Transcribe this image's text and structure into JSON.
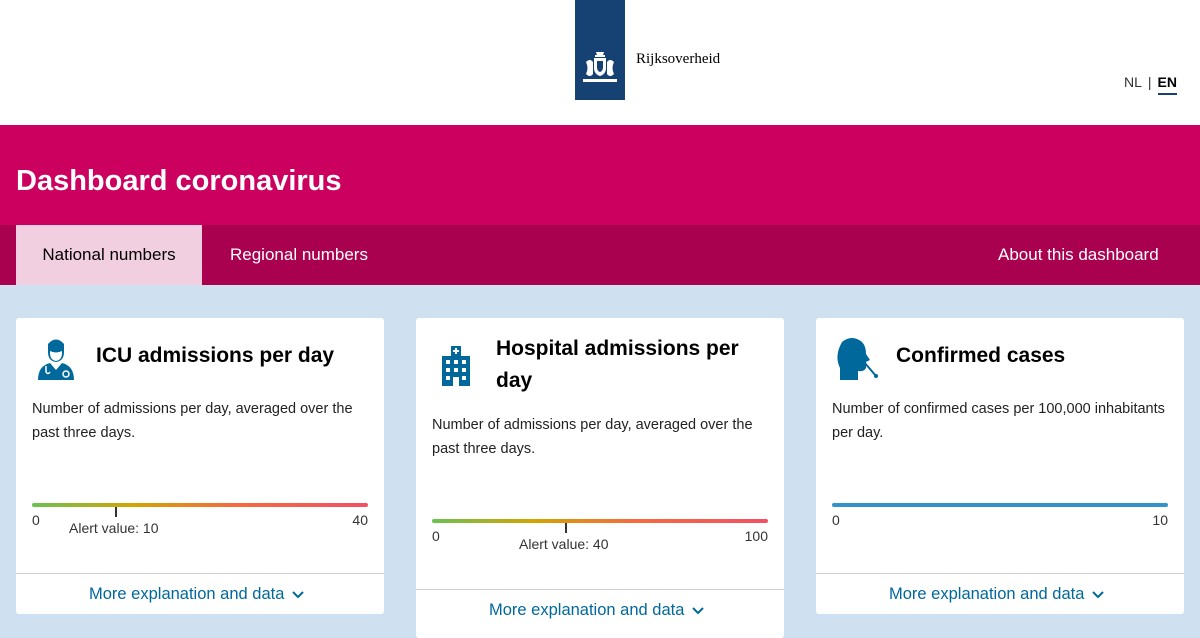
{
  "header": {
    "logo_text": "Rijksoverheid",
    "languages": [
      "NL",
      "EN"
    ],
    "active_language": "EN"
  },
  "banner": {
    "title": "Dashboard coronavirus"
  },
  "tabs": [
    {
      "label": "National numbers",
      "active": true
    },
    {
      "label": "Regional numbers",
      "active": false
    },
    {
      "label": "About this dashboard",
      "active": false
    }
  ],
  "cards": [
    {
      "title": "ICU admissions per day",
      "icon": "doctor-icon",
      "description": "Number of admissions per day, averaged over the past three days.",
      "scale_min": "0",
      "scale_max": "40",
      "alert_label": "Alert value: 10",
      "alert_value": 10,
      "more_label": "More explanation and data"
    },
    {
      "title": "Hospital admissions per day",
      "icon": "hospital-icon",
      "description": "Number of admissions per day, averaged over the past three days.",
      "scale_min": "0",
      "scale_max": "100",
      "alert_label": "Alert value: 40",
      "alert_value": 40,
      "more_label": "More explanation and data"
    },
    {
      "title": "Confirmed cases",
      "icon": "swab-test-icon",
      "description": "Number of confirmed cases per 100,000 inhabitants per day.",
      "scale_min": "0",
      "scale_max": "10",
      "more_label": "More explanation and data"
    }
  ],
  "colors": {
    "brand_magenta": "#cc005e",
    "tab_bar": "#a90050",
    "active_tab": "#f2cfe0",
    "page_bg": "#cfe0f1",
    "logo_blue": "#154273",
    "link_blue": "#01689b",
    "scale_blue": "#3391cc"
  }
}
